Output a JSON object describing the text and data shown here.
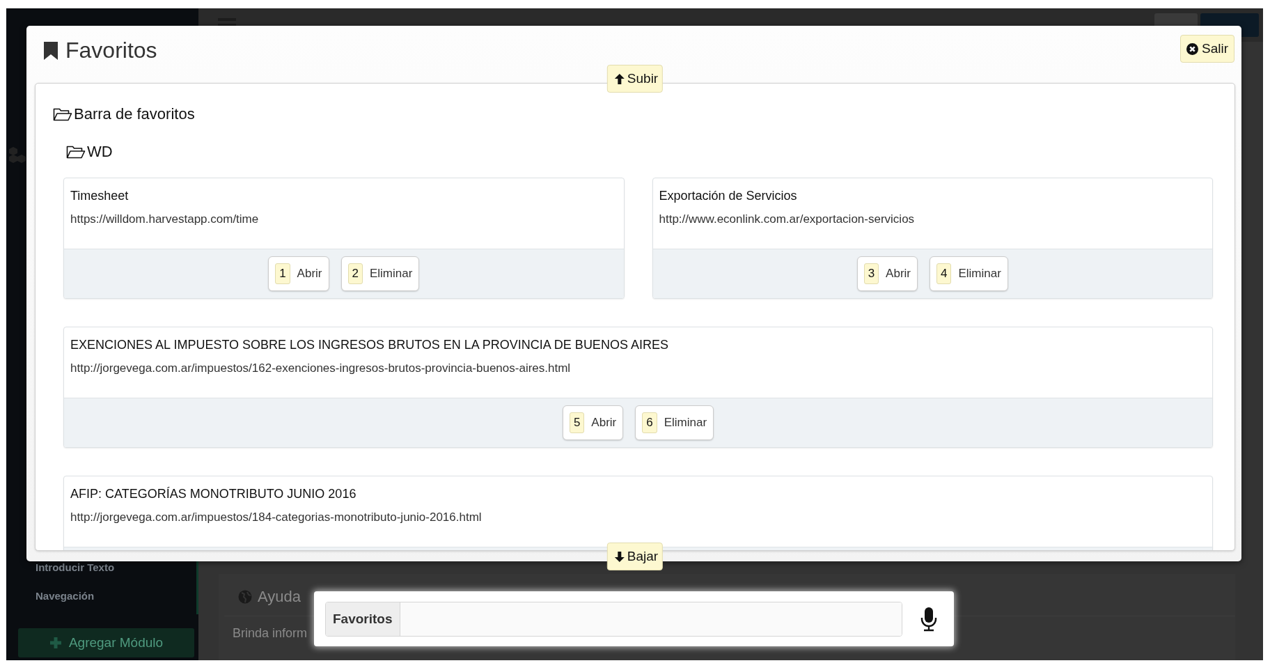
{
  "app": {
    "languages": [
      {
        "selected": false
      },
      {
        "selected": true
      }
    ],
    "sidebar_items": [
      "Introducir Texto",
      "Navegación"
    ],
    "add_module_button": "Agregar Módulo",
    "help_panel": {
      "title": "Ayuda",
      "text": "Brinda inform"
    }
  },
  "dialog": {
    "title": "Favoritos",
    "close_button": "Salir",
    "scroll_up_button": "Subir",
    "scroll_down_button": "Bajar",
    "folder": {
      "name": "Barra de favoritos",
      "children": [
        {
          "name": "WD",
          "bookmarks": [
            {
              "kind": "half",
              "title": "Timesheet",
              "url": "https://willdom.harvestapp.com/time",
              "actions": [
                {
                  "key": "1",
                  "label": "Abrir"
                },
                {
                  "key": "2",
                  "label": "Eliminar"
                }
              ]
            },
            {
              "kind": "half",
              "title": "Exportación de Servicios",
              "url": "http://www.econlink.com.ar/exportacion-servicios",
              "actions": [
                {
                  "key": "3",
                  "label": "Abrir"
                },
                {
                  "key": "4",
                  "label": "Eliminar"
                }
              ]
            },
            {
              "kind": "full",
              "title": "EXENCIONES AL IMPUESTO SOBRE LOS INGRESOS BRUTOS EN LA PROVINCIA DE BUENOS AIRES",
              "url": "http://jorgevega.com.ar/impuestos/162-exenciones-ingresos-brutos-provincia-buenos-aires.html",
              "actions": [
                {
                  "key": "5",
                  "label": "Abrir"
                },
                {
                  "key": "6",
                  "label": "Eliminar"
                }
              ]
            },
            {
              "kind": "full",
              "title": "AFIP: CATEGORÍAS MONOTRIBUTO JUNIO 2016",
              "url": "http://jorgevega.com.ar/impuestos/184-categorias-monotributo-junio-2016.html"
            }
          ]
        }
      ]
    }
  },
  "voice_bar": {
    "label": "Favoritos"
  }
}
